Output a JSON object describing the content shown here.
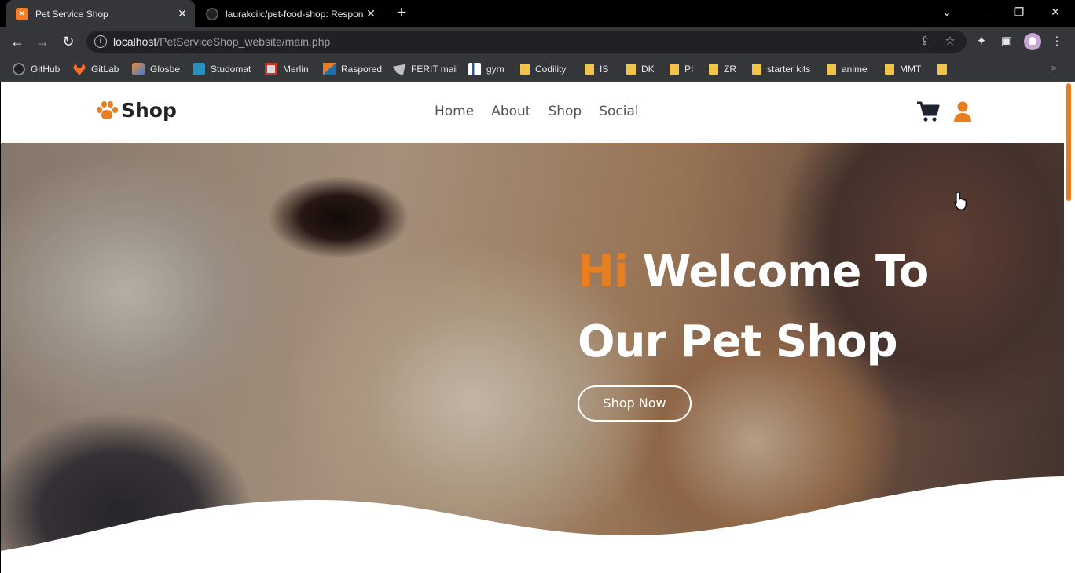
{
  "browser": {
    "tabs": [
      {
        "title": "Pet Service Shop",
        "active": true
      },
      {
        "title": "laurakciic/pet-food-shop: Respon",
        "active": false
      }
    ],
    "url_host": "localhost",
    "url_path": "/PetServiceShop_website/main.php",
    "bookmarks": [
      "GitHub",
      "GitLab",
      "Glosbe",
      "Studomat",
      "Merlin",
      "Raspored",
      "FERIT mail",
      "gym",
      "Codility",
      "IS",
      "DK",
      "PI",
      "ZR",
      "starter kits",
      "anime",
      "MMT"
    ]
  },
  "site": {
    "brand": "Shop",
    "nav": [
      "Home",
      "About",
      "Shop",
      "Social"
    ],
    "hero": {
      "hi": "Hi",
      "line1_rest": " Welcome To",
      "line2": "Our Pet Shop",
      "cta": "Shop Now"
    }
  },
  "colors": {
    "accent": "#e67e22",
    "brand_text": "#222222",
    "nav_text": "#555555",
    "chrome_bg": "#35363a"
  }
}
